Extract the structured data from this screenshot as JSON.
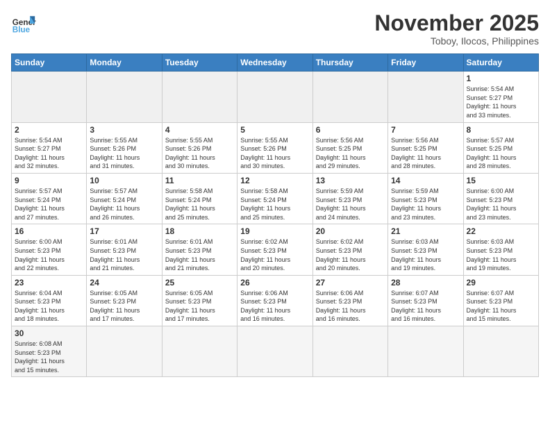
{
  "logo": {
    "text_general": "General",
    "text_blue": "Blue"
  },
  "header": {
    "month": "November 2025",
    "location": "Toboy, Ilocos, Philippines"
  },
  "weekdays": [
    "Sunday",
    "Monday",
    "Tuesday",
    "Wednesday",
    "Thursday",
    "Friday",
    "Saturday"
  ],
  "days": [
    {
      "num": "",
      "info": "",
      "empty": true
    },
    {
      "num": "",
      "info": "",
      "empty": true
    },
    {
      "num": "",
      "info": "",
      "empty": true
    },
    {
      "num": "",
      "info": "",
      "empty": true
    },
    {
      "num": "",
      "info": "",
      "empty": true
    },
    {
      "num": "",
      "info": "",
      "empty": true
    },
    {
      "num": "1",
      "info": "Sunrise: 5:54 AM\nSunset: 5:27 PM\nDaylight: 11 hours\nand 33 minutes."
    },
    {
      "num": "2",
      "info": "Sunrise: 5:54 AM\nSunset: 5:27 PM\nDaylight: 11 hours\nand 32 minutes."
    },
    {
      "num": "3",
      "info": "Sunrise: 5:55 AM\nSunset: 5:26 PM\nDaylight: 11 hours\nand 31 minutes."
    },
    {
      "num": "4",
      "info": "Sunrise: 5:55 AM\nSunset: 5:26 PM\nDaylight: 11 hours\nand 30 minutes."
    },
    {
      "num": "5",
      "info": "Sunrise: 5:55 AM\nSunset: 5:26 PM\nDaylight: 11 hours\nand 30 minutes."
    },
    {
      "num": "6",
      "info": "Sunrise: 5:56 AM\nSunset: 5:25 PM\nDaylight: 11 hours\nand 29 minutes."
    },
    {
      "num": "7",
      "info": "Sunrise: 5:56 AM\nSunset: 5:25 PM\nDaylight: 11 hours\nand 28 minutes."
    },
    {
      "num": "8",
      "info": "Sunrise: 5:57 AM\nSunset: 5:25 PM\nDaylight: 11 hours\nand 28 minutes."
    },
    {
      "num": "9",
      "info": "Sunrise: 5:57 AM\nSunset: 5:24 PM\nDaylight: 11 hours\nand 27 minutes."
    },
    {
      "num": "10",
      "info": "Sunrise: 5:57 AM\nSunset: 5:24 PM\nDaylight: 11 hours\nand 26 minutes."
    },
    {
      "num": "11",
      "info": "Sunrise: 5:58 AM\nSunset: 5:24 PM\nDaylight: 11 hours\nand 25 minutes."
    },
    {
      "num": "12",
      "info": "Sunrise: 5:58 AM\nSunset: 5:24 PM\nDaylight: 11 hours\nand 25 minutes."
    },
    {
      "num": "13",
      "info": "Sunrise: 5:59 AM\nSunset: 5:23 PM\nDaylight: 11 hours\nand 24 minutes."
    },
    {
      "num": "14",
      "info": "Sunrise: 5:59 AM\nSunset: 5:23 PM\nDaylight: 11 hours\nand 23 minutes."
    },
    {
      "num": "15",
      "info": "Sunrise: 6:00 AM\nSunset: 5:23 PM\nDaylight: 11 hours\nand 23 minutes."
    },
    {
      "num": "16",
      "info": "Sunrise: 6:00 AM\nSunset: 5:23 PM\nDaylight: 11 hours\nand 22 minutes."
    },
    {
      "num": "17",
      "info": "Sunrise: 6:01 AM\nSunset: 5:23 PM\nDaylight: 11 hours\nand 21 minutes."
    },
    {
      "num": "18",
      "info": "Sunrise: 6:01 AM\nSunset: 5:23 PM\nDaylight: 11 hours\nand 21 minutes."
    },
    {
      "num": "19",
      "info": "Sunrise: 6:02 AM\nSunset: 5:23 PM\nDaylight: 11 hours\nand 20 minutes."
    },
    {
      "num": "20",
      "info": "Sunrise: 6:02 AM\nSunset: 5:23 PM\nDaylight: 11 hours\nand 20 minutes."
    },
    {
      "num": "21",
      "info": "Sunrise: 6:03 AM\nSunset: 5:23 PM\nDaylight: 11 hours\nand 19 minutes."
    },
    {
      "num": "22",
      "info": "Sunrise: 6:03 AM\nSunset: 5:23 PM\nDaylight: 11 hours\nand 19 minutes."
    },
    {
      "num": "23",
      "info": "Sunrise: 6:04 AM\nSunset: 5:23 PM\nDaylight: 11 hours\nand 18 minutes."
    },
    {
      "num": "24",
      "info": "Sunrise: 6:05 AM\nSunset: 5:23 PM\nDaylight: 11 hours\nand 17 minutes."
    },
    {
      "num": "25",
      "info": "Sunrise: 6:05 AM\nSunset: 5:23 PM\nDaylight: 11 hours\nand 17 minutes."
    },
    {
      "num": "26",
      "info": "Sunrise: 6:06 AM\nSunset: 5:23 PM\nDaylight: 11 hours\nand 16 minutes."
    },
    {
      "num": "27",
      "info": "Sunrise: 6:06 AM\nSunset: 5:23 PM\nDaylight: 11 hours\nand 16 minutes."
    },
    {
      "num": "28",
      "info": "Sunrise: 6:07 AM\nSunset: 5:23 PM\nDaylight: 11 hours\nand 16 minutes."
    },
    {
      "num": "29",
      "info": "Sunrise: 6:07 AM\nSunset: 5:23 PM\nDaylight: 11 hours\nand 15 minutes."
    },
    {
      "num": "30",
      "info": "Sunrise: 6:08 AM\nSunset: 5:23 PM\nDaylight: 11 hours\nand 15 minutes."
    },
    {
      "num": "",
      "info": "",
      "empty": true
    },
    {
      "num": "",
      "info": "",
      "empty": true
    },
    {
      "num": "",
      "info": "",
      "empty": true
    },
    {
      "num": "",
      "info": "",
      "empty": true
    },
    {
      "num": "",
      "info": "",
      "empty": true
    },
    {
      "num": "",
      "info": "",
      "empty": true
    }
  ]
}
